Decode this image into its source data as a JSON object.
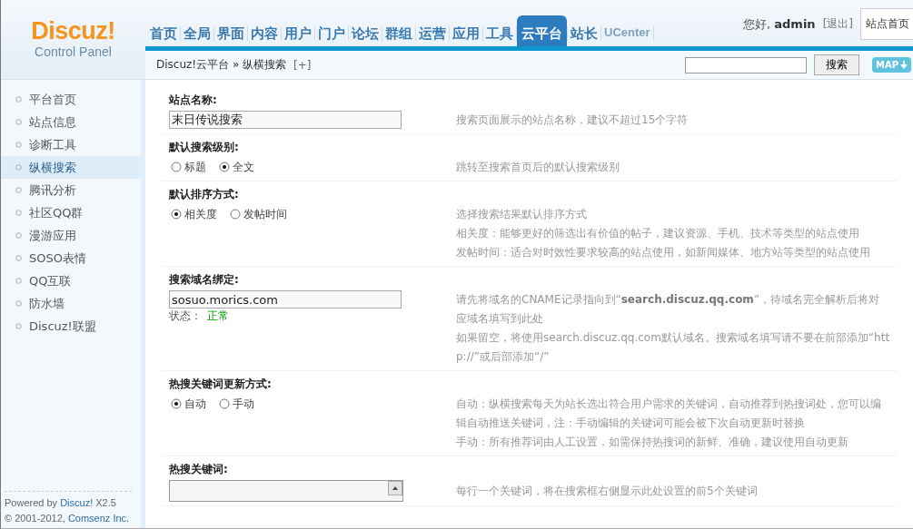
{
  "logo": {
    "brand": "Discuz!",
    "subtitle": "Control Panel"
  },
  "nav": [
    {
      "label": "首页",
      "selected": false
    },
    {
      "label": "全局",
      "selected": false
    },
    {
      "label": "界面",
      "selected": false
    },
    {
      "label": "内容",
      "selected": false
    },
    {
      "label": "用户",
      "selected": false
    },
    {
      "label": "门户",
      "selected": false
    },
    {
      "label": "论坛",
      "selected": false
    },
    {
      "label": "群组",
      "selected": false
    },
    {
      "label": "运营",
      "selected": false
    },
    {
      "label": "应用",
      "selected": false
    },
    {
      "label": "工具",
      "selected": false
    },
    {
      "label": "云平台",
      "selected": true
    },
    {
      "label": "站长",
      "selected": false
    },
    {
      "label": "UCenter",
      "selected": false
    }
  ],
  "user": {
    "greeting": "您好, **admin**",
    "logout": "[退出]",
    "home_button": "站点首页"
  },
  "breadcrumb": {
    "path": "Discuz!云平台 » 纵横搜索",
    "add": "[+]"
  },
  "search": {
    "button": "搜索"
  },
  "map_button": "MAP",
  "sidebar": {
    "items": [
      {
        "label": "平台首页",
        "selected": false
      },
      {
        "label": "站点信息",
        "selected": false
      },
      {
        "label": "诊断工具",
        "selected": false
      },
      {
        "label": "纵横搜索",
        "selected": true
      },
      {
        "label": "腾讯分析",
        "selected": false
      },
      {
        "label": "社区QQ群",
        "selected": false
      },
      {
        "label": "漫游应用",
        "selected": false
      },
      {
        "label": "SOSO表情",
        "selected": false
      },
      {
        "label": "QQ互联",
        "selected": false
      },
      {
        "label": "防水墙",
        "selected": false
      },
      {
        "label": "Discuz!联盟",
        "selected": false
      }
    ],
    "footer": [
      {
        "before": "Powered by ",
        "link": "Discuz!",
        "after": " X2.5"
      },
      {
        "before": "© 2001-2012, ",
        "link": "Comsenz Inc."
      }
    ]
  },
  "settings": [
    {
      "kind": "text",
      "label": "站点名称:",
      "value": "末日传说搜索",
      "help": [
        "搜索页面展示的站点名称，建议不超过15个字符"
      ]
    },
    {
      "kind": "radio",
      "label": "默认搜索级别:",
      "options": [
        {
          "label": "标题",
          "selected": false
        },
        {
          "label": "全文",
          "selected": true
        }
      ],
      "help": [
        "跳转至搜索首页后的默认搜索级别"
      ]
    },
    {
      "kind": "radio",
      "label": "默认排序方式:",
      "options": [
        {
          "label": "相关度",
          "selected": true
        },
        {
          "label": "发帖时间",
          "selected": false
        }
      ],
      "help": [
        "选择搜索结果默认排序方式",
        "相关度：能够更好的筛选出有价值的帖子，建议资源、手机、技术等类型的站点使用",
        "发帖时间：适合对时效性要求较高的站点使用，如新闻媒体、地方站等类型的站点使用"
      ]
    },
    {
      "kind": "text",
      "label": "搜索域名绑定:",
      "value": "sosuo.morics.com",
      "status": {
        "label": "状态：",
        "value": "正常"
      },
      "help": [
        "请先将域名的CNAME记录指向到“**search.discuz.qq.com**”，待域名完全解析后将对应域名填写到此处",
        "如果留空，将使用search.discuz.qq.com默认域名。搜索域名填写请不要在前部添加“http://”或后部添加“/”"
      ]
    },
    {
      "kind": "radio",
      "label": "热搜关键词更新方式:",
      "options": [
        {
          "label": "自动",
          "selected": true
        },
        {
          "label": "手动",
          "selected": false
        }
      ],
      "help": [
        "自动：纵横搜索每天为站长选出符合用户需求的关键词，自动推荐到热搜词处，您可以编辑自动推送关键词，注：手动编辑的关键词可能会被下次自动更新时替换",
        "手动：所有推荐词由人工设置，如需保持热搜词的新鲜、准确，建议使用自动更新"
      ]
    },
    {
      "kind": "textarea",
      "label": "热搜关键词:",
      "help": [
        "每行一个关键词，将在搜索框右侧显示此处设置的前5个关键词"
      ]
    }
  ]
}
